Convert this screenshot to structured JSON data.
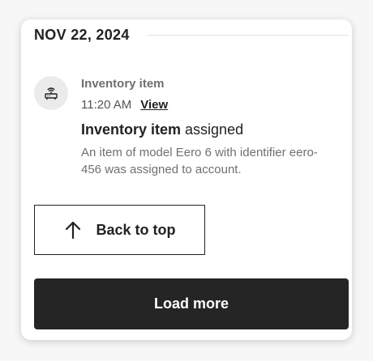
{
  "timeline": {
    "date_heading": "NOV 22, 2024",
    "events": [
      {
        "icon": "router-icon",
        "type_label": "Inventory item",
        "time": "11:20 AM",
        "view_label": "View",
        "title_strong": "Inventory item",
        "title_rest": " assigned",
        "description": "An item of model Eero 6 with identifier eero-456 was assigned to account."
      }
    ]
  },
  "actions": {
    "back_to_top_label": "Back to top",
    "back_to_top_icon": "arrow-up-icon",
    "load_more_label": "Load more"
  },
  "colors": {
    "primary_button": "#252525",
    "icon_circle": "#ebebeb",
    "muted_text": "#707070"
  }
}
